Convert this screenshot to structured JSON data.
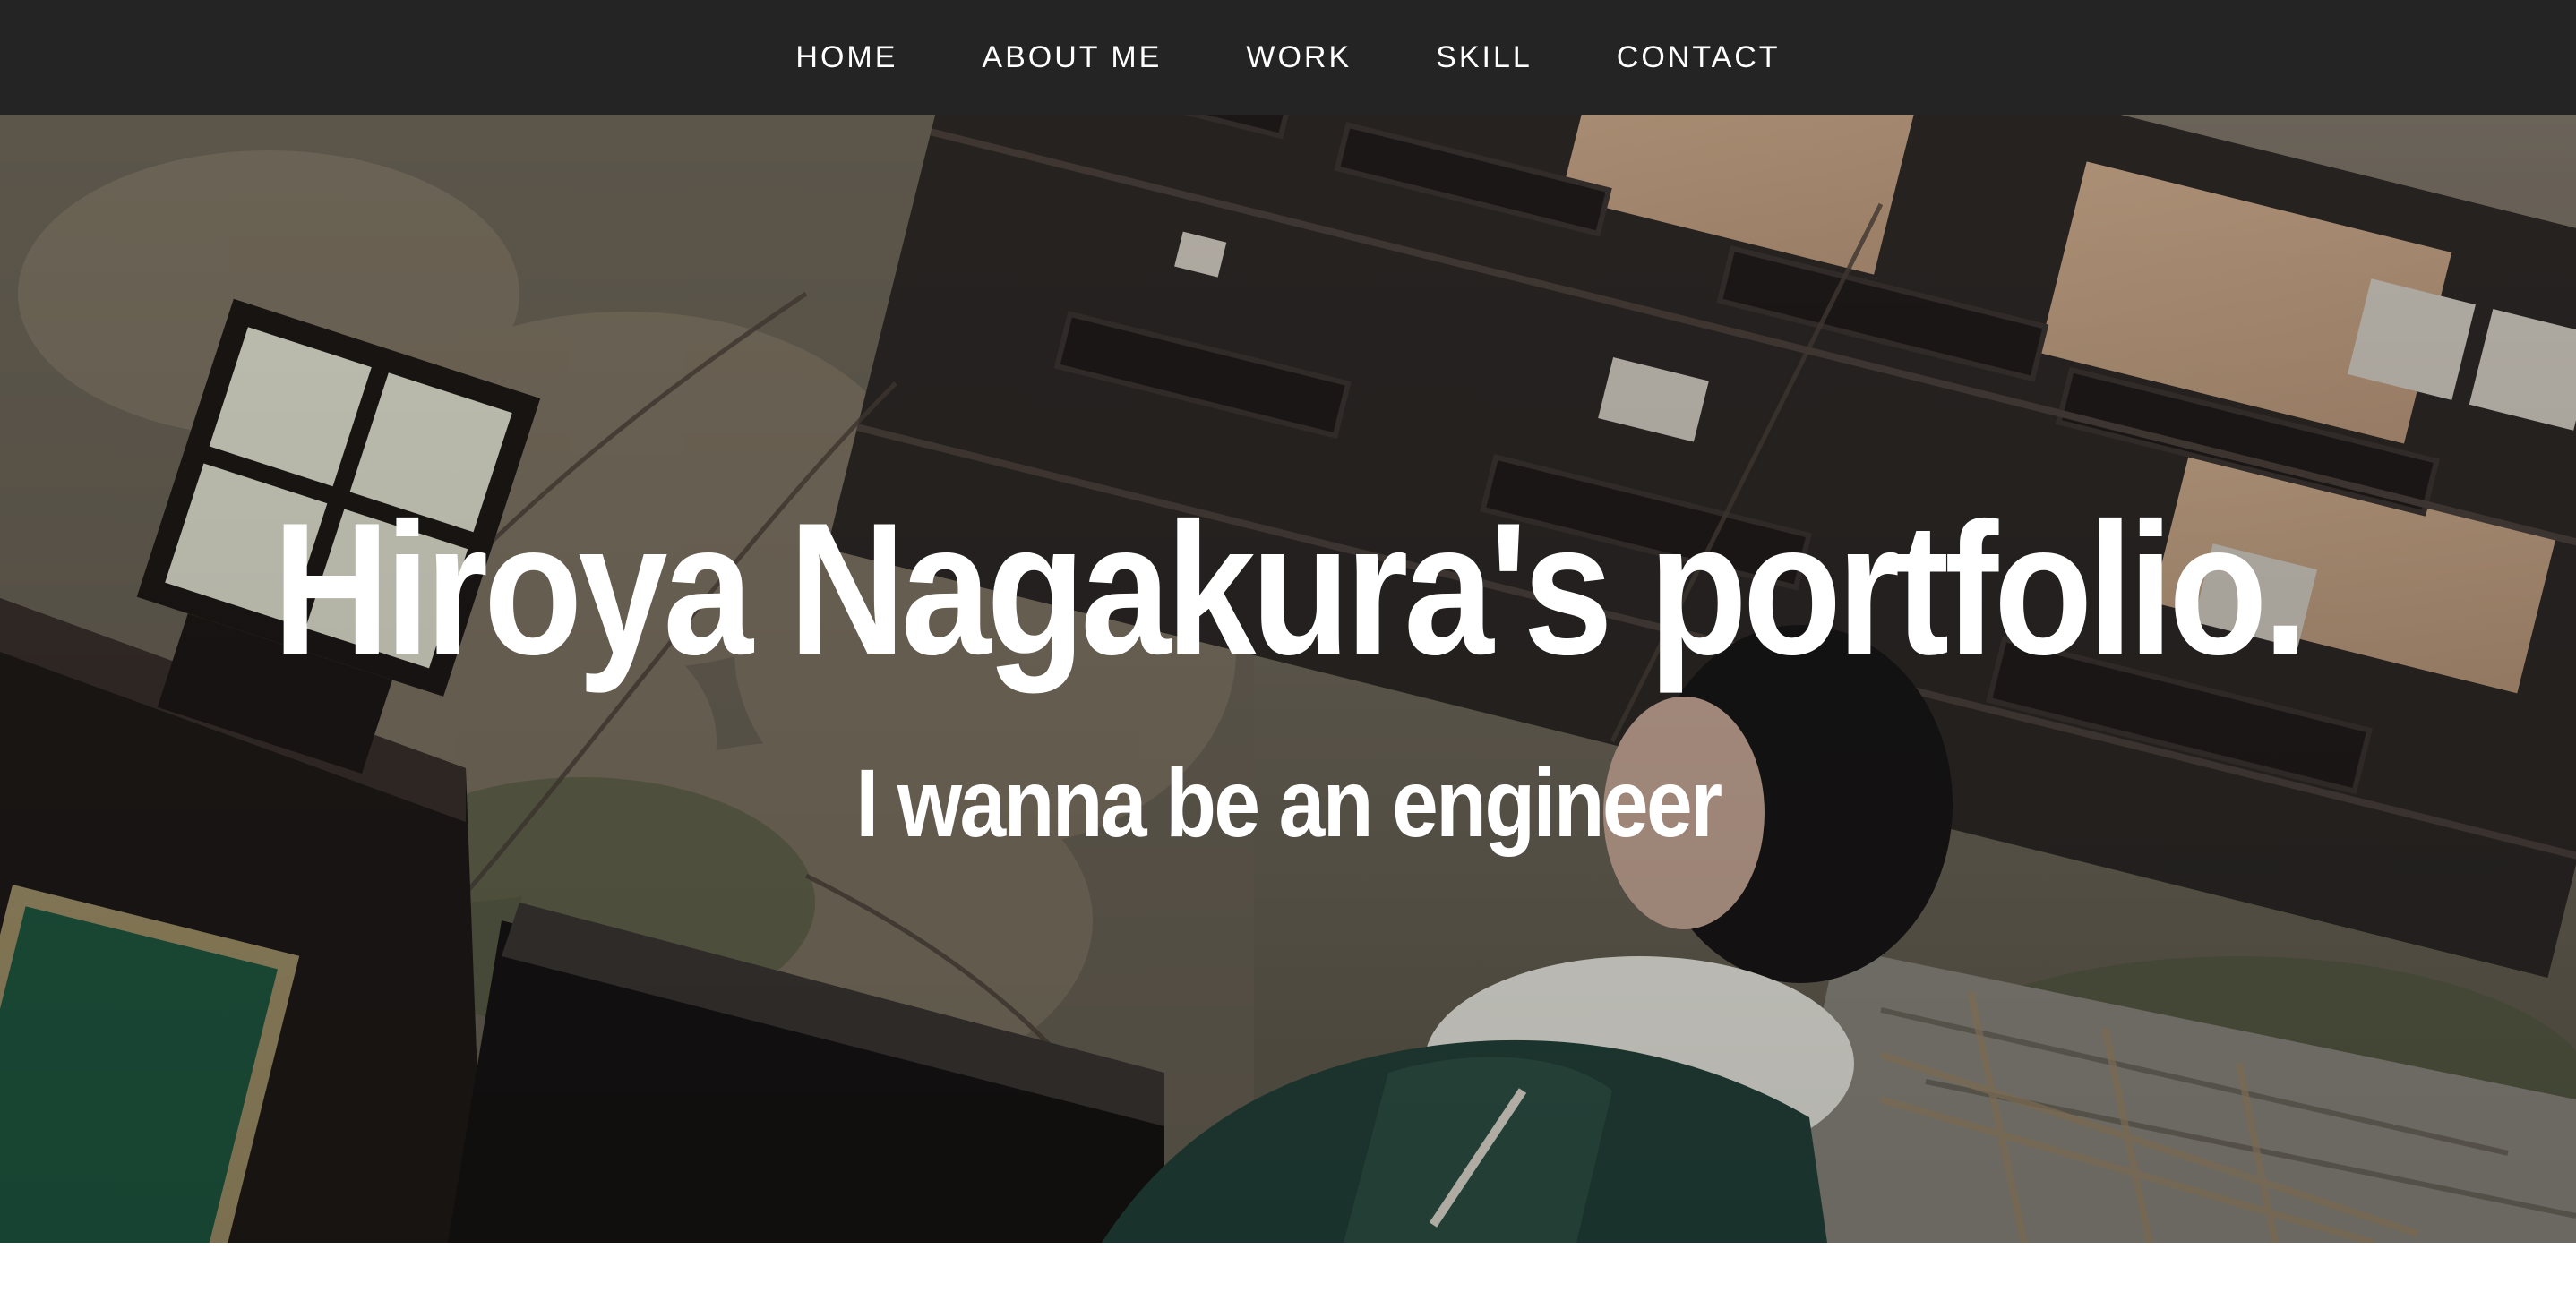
{
  "nav": {
    "items": [
      {
        "label": "HOME"
      },
      {
        "label": "ABOUT ME"
      },
      {
        "label": "WORK"
      },
      {
        "label": "SKILL"
      },
      {
        "label": "CONTACT"
      }
    ]
  },
  "hero": {
    "title": "Hiroya Nagakura's portfolio.",
    "subtitle": "I wanna be an engineer"
  },
  "colors": {
    "navbar_bg": "#242424",
    "nav_text": "#ffffff",
    "hero_text": "#ffffff"
  }
}
